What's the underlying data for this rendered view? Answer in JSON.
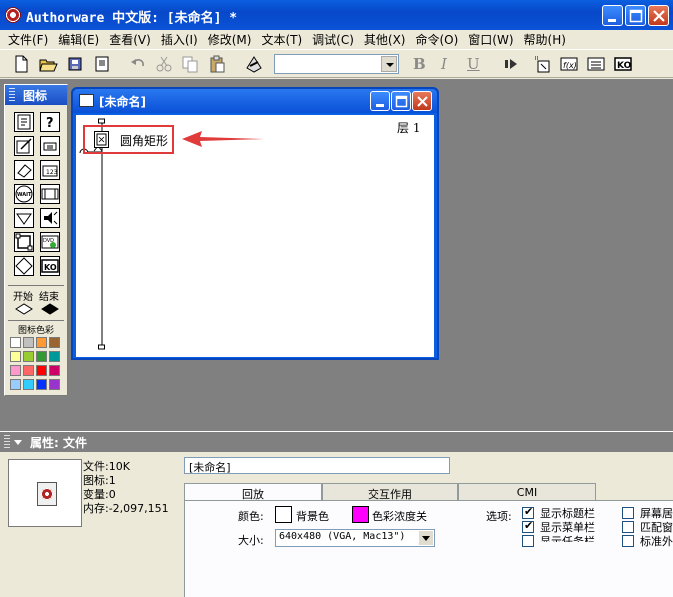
{
  "window": {
    "title": "Authorware 中文版: [未命名] *"
  },
  "menubar": {
    "items": [
      "文件(F)",
      "编辑(E)",
      "查看(V)",
      "插入(I)",
      "修改(M)",
      "文本(T)",
      "调试(C)",
      "其他(X)",
      "命令(O)",
      "窗口(W)",
      "帮助(H)"
    ]
  },
  "toolbar": {
    "font_value": "",
    "bold_label": "B",
    "italic_label": "I",
    "underline_label": "U",
    "icons": [
      "new-icon",
      "open-icon",
      "save-all-icon",
      "import-icon",
      "undo-icon",
      "cut-icon",
      "copy-icon",
      "paste-icon",
      "find-icon",
      "run-icon",
      "control-panel-icon",
      "functions-icon",
      "variables-icon",
      "knowledge-objects-icon"
    ]
  },
  "palette": {
    "title": "图标",
    "start_label": "开始",
    "end_label": "结束",
    "colors_label": "图标色彩",
    "swatches": [
      "#FFFFFF",
      "#C0C0C0",
      "#FF9933",
      "#996633",
      "#FFFF99",
      "#99CC33",
      "#339933",
      "#009999",
      "#FF99CC",
      "#FF6666",
      "#FF0000",
      "#CC0066",
      "#99CCFF",
      "#33CCFF",
      "#0033FF",
      "#9933CC"
    ]
  },
  "flowline": {
    "title": "[未命名]",
    "level": "层 1",
    "icon_label": "圆角矩形"
  },
  "properties": {
    "title": "属性: 文件",
    "file_size": "文件:10K",
    "icon_count": "图标:1",
    "var_count": "变量:0",
    "memory": "内存:-2,097,151",
    "filename": "[未命名]",
    "tabs": [
      "回放",
      "交互作用",
      "CMI"
    ],
    "color_label": "颜色:",
    "background_label": "背景色",
    "chroma_label": "色彩浓度关",
    "size_label": "大小:",
    "size_value": "640x480 (VGA, Mac13\")",
    "options_label": "选项:",
    "opt_title_bar": "显示标题栏",
    "opt_menu_bar": "显示菜单栏",
    "opt_task_bar": "显示任务栏",
    "opt_screen_center": "屏幕居",
    "opt_match_window": "匹配窗",
    "opt_standard": "标准外",
    "background_color": "#FFFFFF",
    "chroma_color": "#FF00FF"
  },
  "colors": {
    "accent": "#0A5FE0",
    "annotation": "#E03A3A"
  }
}
